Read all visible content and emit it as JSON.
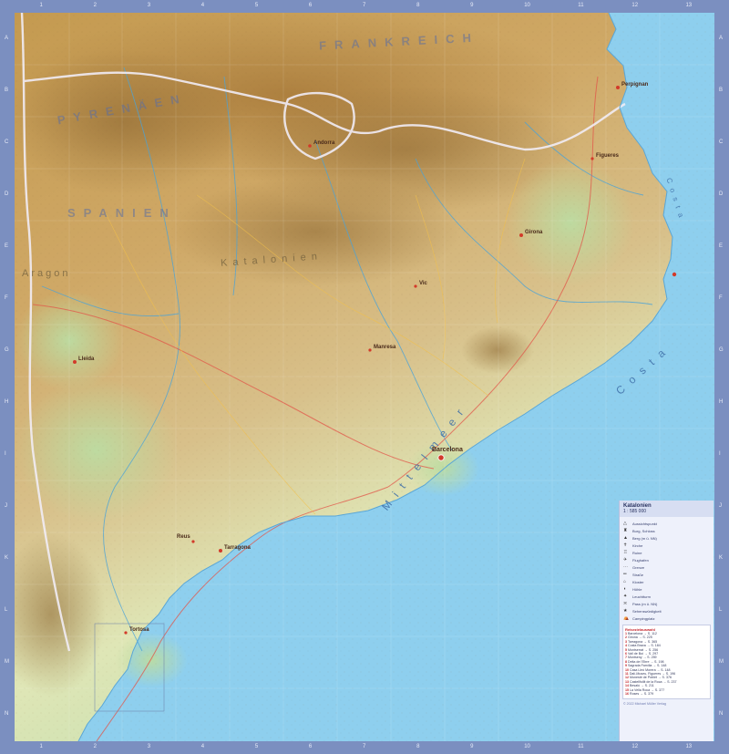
{
  "map": {
    "labels": {
      "frankreich": "FRANKREICH",
      "pyrenaeen": "PYRENÄEN",
      "spanien": "SPANIEN",
      "spanien_west": "SPANIEN",
      "aragon": "Aragon",
      "katalonien": "Katalonien",
      "mittelmeer": "Mittelmeer",
      "costa": "Costa",
      "costa_top": "Costa",
      "barcelona": "Barcelona",
      "perpignan": "Perpignan",
      "girona": "Girona",
      "lleida": "Lleida",
      "tarragona": "Tarragona",
      "andorra": "Andorra",
      "figueres": "Figueres",
      "vic": "Vic",
      "manresa": "Manresa",
      "reus": "Reus",
      "tortosa": "Tortosa"
    },
    "grid": {
      "columns": [
        "1",
        "2",
        "3",
        "4",
        "5",
        "6",
        "7",
        "8",
        "9",
        "10",
        "11",
        "12",
        "13"
      ],
      "rows": [
        "A",
        "B",
        "C",
        "D",
        "E",
        "F",
        "G",
        "H",
        "I",
        "J",
        "K",
        "L",
        "M",
        "N"
      ]
    },
    "colors": {
      "sea": "#8ecfee",
      "frame": "#7b8fc0",
      "mountain": "#c79d52",
      "lowland": "#cfe3a8"
    }
  },
  "legend": {
    "title": "Katalonien",
    "scale": "1 : 585 000",
    "items": [
      {
        "icon": "viewpoint-icon",
        "symbol": "△",
        "label": "Aussichtspunkt"
      },
      {
        "icon": "castle-icon",
        "symbol": "♜",
        "label": "Burg, Schloss"
      },
      {
        "icon": "mountain-icon",
        "symbol": "▲",
        "label": "Berg (m ü. NN)"
      },
      {
        "icon": "church-icon",
        "symbol": "✝",
        "label": "Kirche"
      },
      {
        "icon": "ruin-icon",
        "symbol": "♖",
        "label": "Ruine"
      },
      {
        "icon": "airport-icon",
        "symbol": "✈",
        "label": "Flughafen"
      },
      {
        "icon": "border-icon",
        "symbol": "⋯",
        "label": "Grenze"
      },
      {
        "icon": "road-icon",
        "symbol": "═",
        "label": "Straße"
      },
      {
        "icon": "monastery-icon",
        "symbol": "⌂",
        "label": "Kloster"
      },
      {
        "icon": "cave-icon",
        "symbol": "◖",
        "label": "Höhle"
      },
      {
        "icon": "lighthouse-icon",
        "symbol": "✦",
        "label": "Leuchtturm"
      },
      {
        "icon": "pass-icon",
        "symbol": "≍",
        "label": "Pass (m ü. NN)"
      },
      {
        "icon": "sight-icon",
        "symbol": "★",
        "label": "Sehenswürdigkeit"
      },
      {
        "icon": "camping-icon",
        "symbol": "⛺",
        "label": "Campingplatz"
      }
    ],
    "box": {
      "title": "Reisezielauswahl",
      "rows": [
        {
          "num": "1",
          "text": "Barcelona → S. 112"
        },
        {
          "num": "2",
          "text": "Girona → S. 225"
        },
        {
          "num": "3",
          "text": "Tarragona → S. 365"
        },
        {
          "num": "4",
          "text": "Costa Brava → S. 184"
        },
        {
          "num": "5",
          "text": "Montserrat → S. 256"
        },
        {
          "num": "6",
          "text": "Vall de Boí → S. 297"
        },
        {
          "num": "7",
          "text": "Montseny → S. 259"
        },
        {
          "num": "8",
          "text": "Delta de l'Ebre → S. 198"
        },
        {
          "num": "9",
          "text": "Sagrada Família → S. 148"
        },
        {
          "num": "10",
          "text": "Casa Lleó Morera → S. 148"
        },
        {
          "num": "11",
          "text": "Dalí-Museu, Figueres → S. 196"
        },
        {
          "num": "12",
          "text": "Monestir de Poblet → S. 376"
        },
        {
          "num": "13",
          "text": "Castellfollit de la Roca → S. 237"
        },
        {
          "num": "14",
          "text": "Besalú → S. 211"
        },
        {
          "num": "15",
          "text": "La Vella Roca → S. 377"
        },
        {
          "num": "16",
          "text": "Roses → S. 379"
        }
      ]
    },
    "footer": "© 2022 Michael Müller Verlag"
  }
}
